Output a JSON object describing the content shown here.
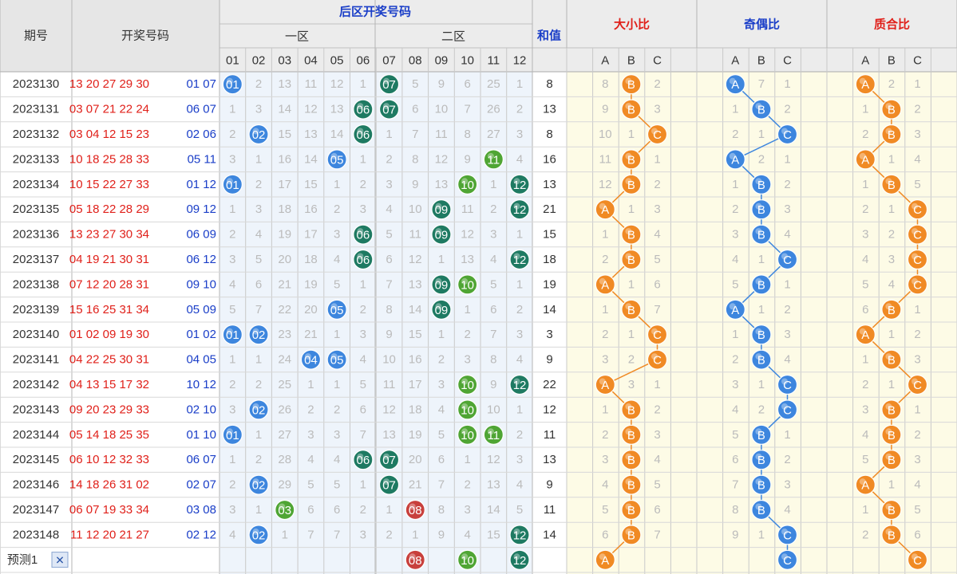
{
  "colors": {
    "red_ball": "#c8403c",
    "green_ball": "#4fa534",
    "teal_ball": "#1e7a62",
    "blue_ball": "#3d86de",
    "orange_ball": "#f08a24",
    "grey_cell": "#9a9a9a",
    "blue_text": "#1a3ec8",
    "red_text": "#e0201a",
    "period_text": "#1a3ec8"
  },
  "header": {
    "period": "期号",
    "draw": "开奖号码",
    "back_zone": "后区开奖号码",
    "zone1": "一区",
    "zone2": "二区",
    "sum": "和值",
    "size_ratio": "大小比",
    "odd_even_ratio": "奇偶比",
    "prime_ratio": "质合比",
    "back_numbers": [
      "01",
      "02",
      "03",
      "04",
      "05",
      "06",
      "07",
      "08",
      "09",
      "10",
      "11",
      "12"
    ],
    "abc": [
      "A",
      "B",
      "C"
    ]
  },
  "footer": {
    "predict_label": "预测1",
    "close_symbol": "✕"
  },
  "chart_data": {
    "type": "table",
    "title": "后区开奖号码",
    "rows": [
      {
        "period": "2023130",
        "front": "13 20 27 29 30",
        "back": "01 07",
        "cells": [
          "01",
          "2",
          "13",
          "11",
          "12",
          "1",
          "07",
          "5",
          "9",
          "6",
          "25",
          "1"
        ],
        "sum": "8",
        "dx": [
          "8",
          "B",
          "2"
        ],
        "jo": [
          "A",
          "7",
          "1"
        ],
        "zh": [
          "A",
          "2",
          "1"
        ]
      },
      {
        "period": "2023131",
        "front": "03 07 21 22 24",
        "back": "06 07",
        "cells": [
          "1",
          "3",
          "14",
          "12",
          "13",
          "06",
          "07",
          "6",
          "10",
          "7",
          "26",
          "2"
        ],
        "sum": "13",
        "dx": [
          "9",
          "B",
          "3"
        ],
        "jo": [
          "1",
          "B",
          "2"
        ],
        "zh": [
          "1",
          "B",
          "2"
        ]
      },
      {
        "period": "2023132",
        "front": "03 04 12 15 23",
        "back": "02 06",
        "cells": [
          "2",
          "02",
          "15",
          "13",
          "14",
          "06",
          "1",
          "7",
          "11",
          "8",
          "27",
          "3"
        ],
        "sum": "8",
        "dx": [
          "10",
          "1",
          "C"
        ],
        "jo": [
          "2",
          "1",
          "C"
        ],
        "zh": [
          "2",
          "B",
          "3"
        ]
      },
      {
        "period": "2023133",
        "front": "10 18 25 28 33",
        "back": "05 11",
        "cells": [
          "3",
          "1",
          "16",
          "14",
          "05",
          "1",
          "2",
          "8",
          "12",
          "9",
          "11",
          "4"
        ],
        "sum": "16",
        "dx": [
          "11",
          "B",
          "1"
        ],
        "jo": [
          "A",
          "2",
          "1"
        ],
        "zh": [
          "A",
          "1",
          "4"
        ]
      },
      {
        "period": "2023134",
        "front": "10 15 22 27 33",
        "back": "01 12",
        "cells": [
          "01",
          "2",
          "17",
          "15",
          "1",
          "2",
          "3",
          "9",
          "13",
          "10",
          "1",
          "12"
        ],
        "sum": "13",
        "dx": [
          "12",
          "B",
          "2"
        ],
        "jo": [
          "1",
          "B",
          "2"
        ],
        "zh": [
          "1",
          "B",
          "5"
        ]
      },
      {
        "period": "2023135",
        "front": "05 18 22 28 29",
        "back": "09 12",
        "cells": [
          "1",
          "3",
          "18",
          "16",
          "2",
          "3",
          "4",
          "10",
          "09",
          "11",
          "2",
          "12"
        ],
        "sum": "21",
        "dx": [
          "A",
          "1",
          "3"
        ],
        "jo": [
          "2",
          "B",
          "3"
        ],
        "zh": [
          "2",
          "1",
          "C"
        ]
      },
      {
        "period": "2023136",
        "front": "13 23 27 30 34",
        "back": "06 09",
        "cells": [
          "2",
          "4",
          "19",
          "17",
          "3",
          "06",
          "5",
          "11",
          "09",
          "12",
          "3",
          "1"
        ],
        "sum": "15",
        "dx": [
          "1",
          "B",
          "4"
        ],
        "jo": [
          "3",
          "B",
          "4"
        ],
        "zh": [
          "3",
          "2",
          "C"
        ]
      },
      {
        "period": "2023137",
        "front": "04 19 21 30 31",
        "back": "06 12",
        "cells": [
          "3",
          "5",
          "20",
          "18",
          "4",
          "06",
          "6",
          "12",
          "1",
          "13",
          "4",
          "12"
        ],
        "sum": "18",
        "dx": [
          "2",
          "B",
          "5"
        ],
        "jo": [
          "4",
          "1",
          "C"
        ],
        "zh": [
          "4",
          "3",
          "C"
        ]
      },
      {
        "period": "2023138",
        "front": "07 12 20 28 31",
        "back": "09 10",
        "cells": [
          "4",
          "6",
          "21",
          "19",
          "5",
          "1",
          "7",
          "13",
          "09",
          "10",
          "5",
          "1"
        ],
        "sum": "19",
        "dx": [
          "A",
          "1",
          "6"
        ],
        "jo": [
          "5",
          "B",
          "1"
        ],
        "zh": [
          "5",
          "4",
          "C"
        ]
      },
      {
        "period": "2023139",
        "front": "15 16 25 31 34",
        "back": "05 09",
        "cells": [
          "5",
          "7",
          "22",
          "20",
          "05",
          "2",
          "8",
          "14",
          "09",
          "1",
          "6",
          "2"
        ],
        "sum": "14",
        "dx": [
          "1",
          "B",
          "7"
        ],
        "jo": [
          "A",
          "1",
          "2"
        ],
        "zh": [
          "6",
          "B",
          "1"
        ]
      },
      {
        "period": "2023140",
        "front": "01 02 09 19 30",
        "back": "01 02",
        "cells": [
          "01",
          "02",
          "23",
          "21",
          "1",
          "3",
          "9",
          "15",
          "1",
          "2",
          "7",
          "3"
        ],
        "sum": "3",
        "dx": [
          "2",
          "1",
          "C"
        ],
        "jo": [
          "1",
          "B",
          "3"
        ],
        "zh": [
          "A",
          "1",
          "2"
        ]
      },
      {
        "period": "2023141",
        "front": "04 22 25 30 31",
        "back": "04 05",
        "cells": [
          "1",
          "1",
          "24",
          "04",
          "05",
          "4",
          "10",
          "16",
          "2",
          "3",
          "8",
          "4"
        ],
        "sum": "9",
        "dx": [
          "3",
          "2",
          "C"
        ],
        "jo": [
          "2",
          "B",
          "4"
        ],
        "zh": [
          "1",
          "B",
          "3"
        ]
      },
      {
        "period": "2023142",
        "front": "04 13 15 17 32",
        "back": "10 12",
        "cells": [
          "2",
          "2",
          "25",
          "1",
          "1",
          "5",
          "11",
          "17",
          "3",
          "10",
          "9",
          "12"
        ],
        "sum": "22",
        "dx": [
          "A",
          "3",
          "1"
        ],
        "jo": [
          "3",
          "1",
          "C"
        ],
        "zh": [
          "2",
          "1",
          "C"
        ]
      },
      {
        "period": "2023143",
        "front": "09 20 23 29 33",
        "back": "02 10",
        "cells": [
          "3",
          "02",
          "26",
          "2",
          "2",
          "6",
          "12",
          "18",
          "4",
          "10",
          "10",
          "1"
        ],
        "sum": "12",
        "dx": [
          "1",
          "B",
          "2"
        ],
        "jo": [
          "4",
          "2",
          "C"
        ],
        "zh": [
          "3",
          "B",
          "1"
        ]
      },
      {
        "period": "2023144",
        "front": "05 14 18 25 35",
        "back": "01 10",
        "cells": [
          "01",
          "1",
          "27",
          "3",
          "3",
          "7",
          "13",
          "19",
          "5",
          "10",
          "11",
          "2"
        ],
        "sum": "11",
        "dx": [
          "2",
          "B",
          "3"
        ],
        "jo": [
          "5",
          "B",
          "1"
        ],
        "zh": [
          "4",
          "B",
          "2"
        ]
      },
      {
        "period": "2023145",
        "front": "06 10 12 32 33",
        "back": "06 07",
        "cells": [
          "1",
          "2",
          "28",
          "4",
          "4",
          "06",
          "07",
          "20",
          "6",
          "1",
          "12",
          "3"
        ],
        "sum": "13",
        "dx": [
          "3",
          "B",
          "4"
        ],
        "jo": [
          "6",
          "B",
          "2"
        ],
        "zh": [
          "5",
          "B",
          "3"
        ]
      },
      {
        "period": "2023146",
        "front": "14 18 26 31 02",
        "back": "02 07",
        "cells": [
          "2",
          "02",
          "29",
          "5",
          "5",
          "1",
          "07",
          "21",
          "7",
          "2",
          "13",
          "4"
        ],
        "sum": "9",
        "dx": [
          "4",
          "B",
          "5"
        ],
        "jo": [
          "7",
          "B",
          "3"
        ],
        "zh": [
          "A",
          "1",
          "4"
        ]
      },
      {
        "period": "2023147",
        "front": "06 07 19 33 34",
        "back": "03 08",
        "cells": [
          "3",
          "1",
          "03",
          "6",
          "6",
          "2",
          "1",
          "08",
          "8",
          "3",
          "14",
          "5"
        ],
        "sum": "11",
        "dx": [
          "5",
          "B",
          "6"
        ],
        "jo": [
          "8",
          "B",
          "4"
        ],
        "zh": [
          "1",
          "B",
          "5"
        ]
      },
      {
        "period": "2023148",
        "front": "11 12 20 21 27",
        "back": "02 12",
        "cells": [
          "4",
          "02",
          "1",
          "7",
          "7",
          "3",
          "2",
          "1",
          "9",
          "4",
          "15",
          "12"
        ],
        "sum": "14",
        "dx": [
          "6",
          "B",
          "7"
        ],
        "jo": [
          "9",
          "1",
          "C"
        ],
        "zh": [
          "2",
          "B",
          "6"
        ]
      }
    ],
    "predict": {
      "cells": [
        "",
        "",
        "",
        "",
        "",
        "",
        "",
        "08",
        "",
        "10",
        "",
        "12"
      ],
      "dx": [
        "A",
        "",
        ""
      ],
      "jo": [
        "",
        "",
        "C"
      ],
      "zh": [
        "",
        "",
        "C"
      ]
    }
  }
}
